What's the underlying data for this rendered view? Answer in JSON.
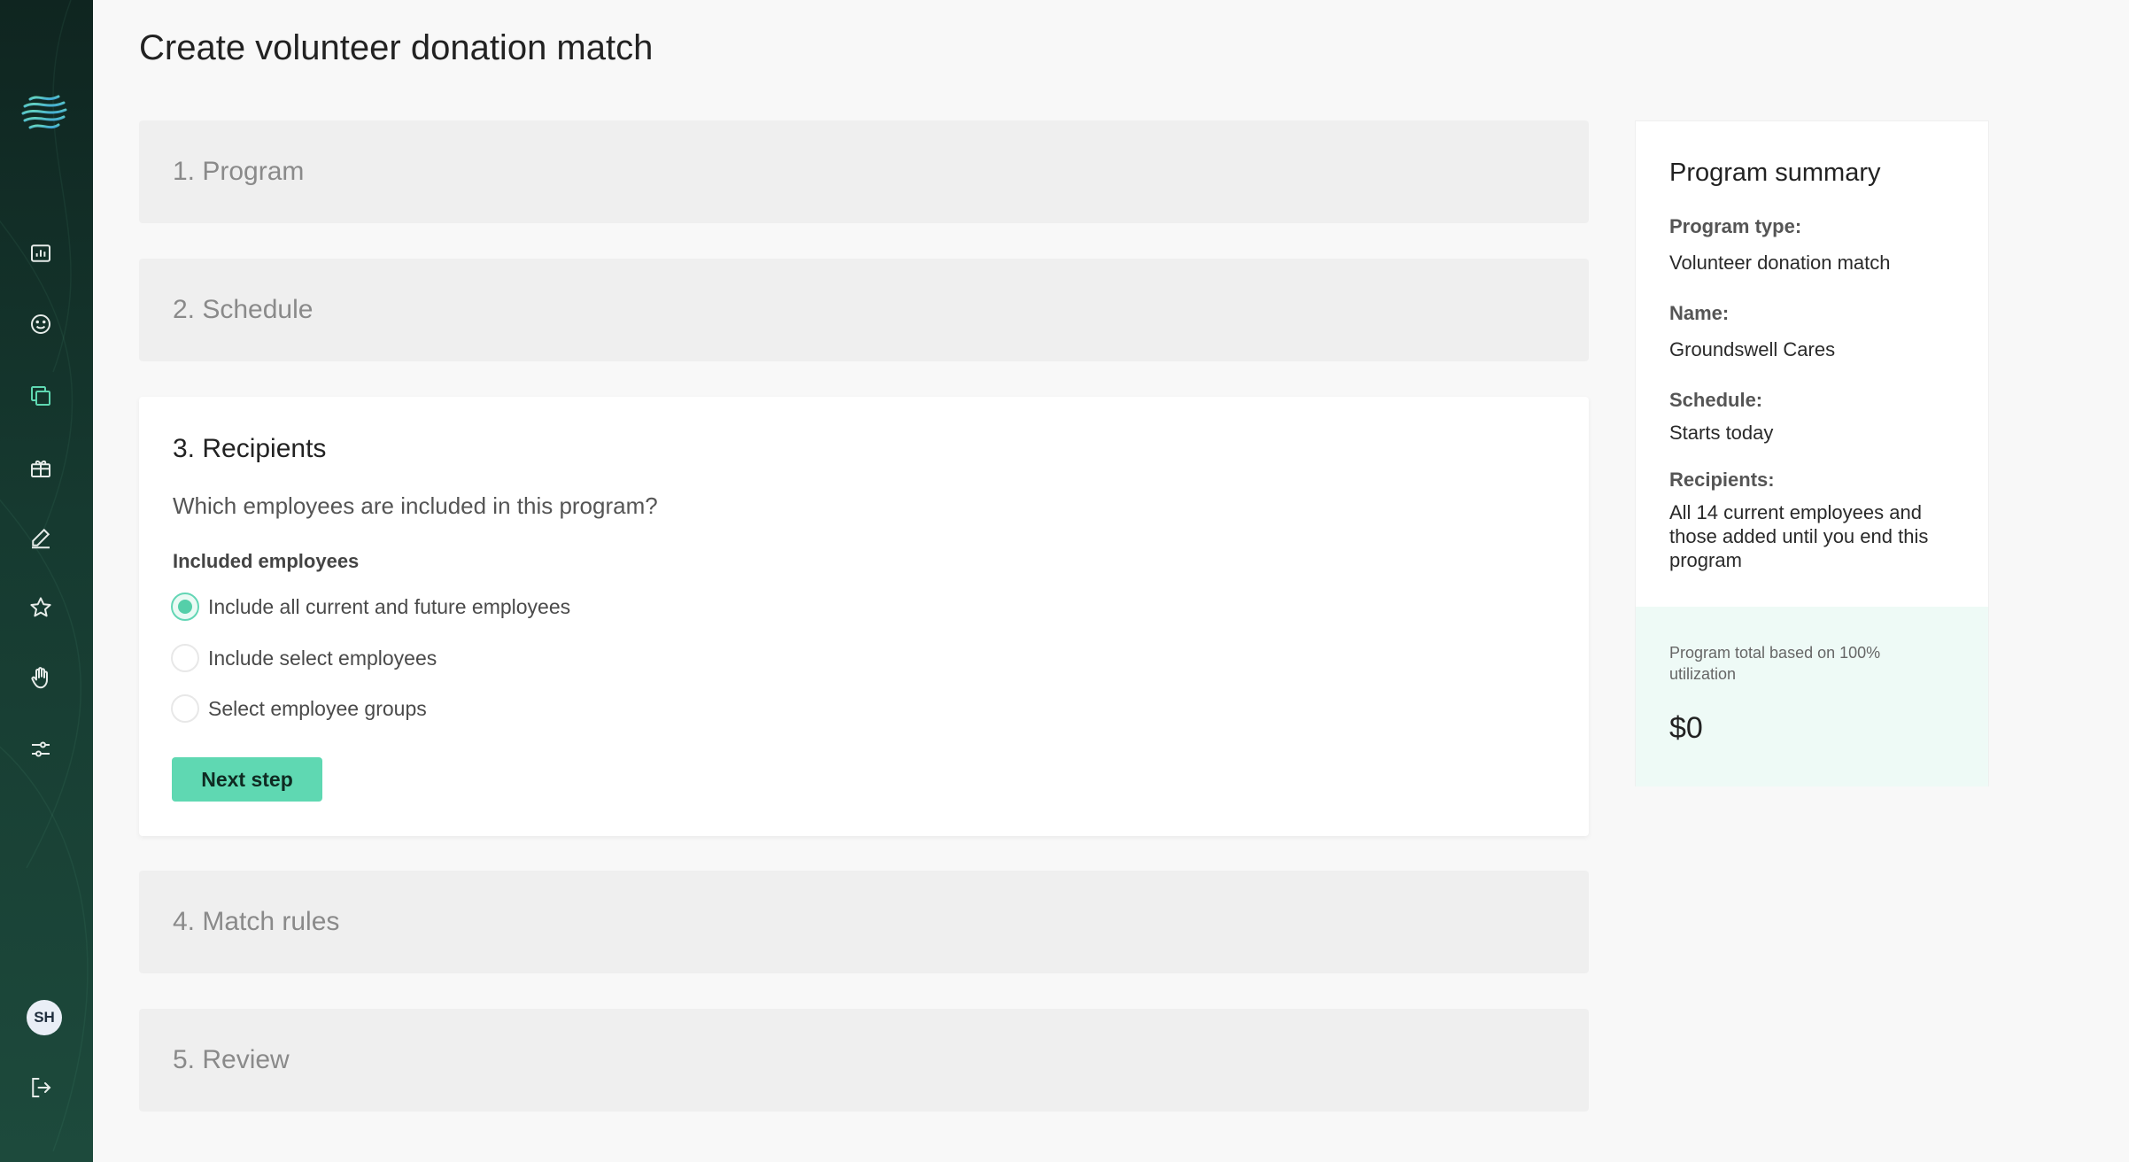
{
  "sidebar": {
    "logo": "wave-logo",
    "nav_items": [
      {
        "icon": "bar-chart-icon"
      },
      {
        "icon": "smiley-icon"
      },
      {
        "icon": "copy-icon",
        "active": true,
        "color": "#5fd8b2"
      },
      {
        "icon": "gift-icon"
      },
      {
        "icon": "pencil-icon"
      },
      {
        "icon": "star-icon"
      },
      {
        "icon": "hand-icon"
      },
      {
        "icon": "sliders-icon"
      }
    ],
    "avatar_initials": "SH",
    "logout_icon": "logout-icon"
  },
  "page": {
    "title": "Create volunteer donation match"
  },
  "steps": [
    {
      "title": "1. Program"
    },
    {
      "title": "2. Schedule"
    },
    {
      "title": "3. Recipients",
      "question": "Which employees are included in this program?",
      "group_label": "Included employees",
      "options": [
        {
          "label": "Include all current and future employees",
          "checked": true
        },
        {
          "label": "Include select employees",
          "checked": false
        },
        {
          "label": "Select employee groups",
          "checked": false
        }
      ],
      "next_label": "Next step"
    },
    {
      "title": "4. Match rules"
    },
    {
      "title": "5. Review"
    }
  ],
  "summary": {
    "title": "Program summary",
    "program_type_label": "Program type:",
    "program_type_value": "Volunteer donation match",
    "name_label": "Name:",
    "name_value": "Groundswell Cares",
    "schedule_label": "Schedule:",
    "schedule_value": "Starts today",
    "recipients_label": "Recipients:",
    "recipients_value": "All 14 current employees and those added until you end this program",
    "footer_note": "Program total based on 100% utilization",
    "total": "$0"
  },
  "colors": {
    "accent": "#5fd8b2",
    "sidebar_bg": "#163a30"
  }
}
